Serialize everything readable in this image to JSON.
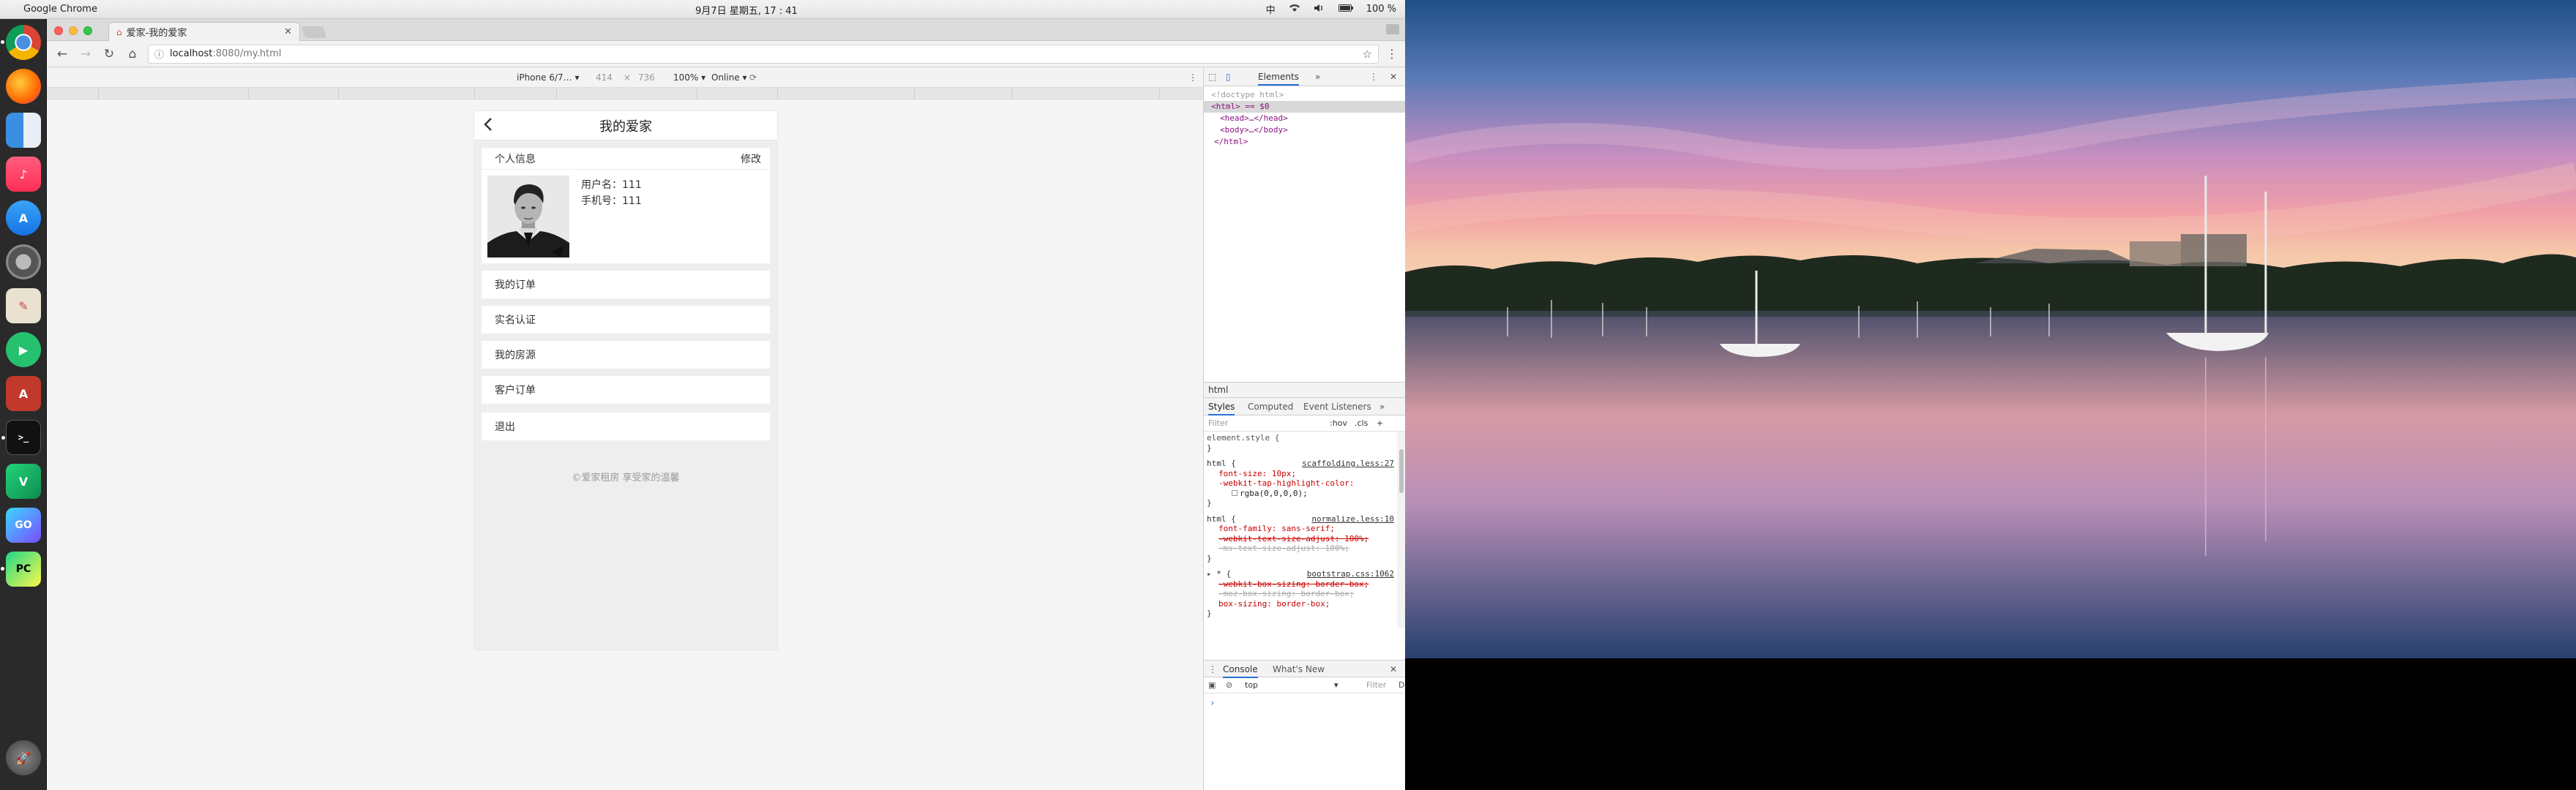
{
  "menubar": {
    "app_name": "Google Chrome",
    "clock": "9月7日 星期五, 17 : 41",
    "input_method": "中",
    "battery": "100 %"
  },
  "browser": {
    "tab_title": "爱家-我的爱家",
    "url_host": "localhost",
    "url_path": ":8080/my.html"
  },
  "device_toolbar": {
    "device": "iPhone 6/7…",
    "width": "414",
    "times": "×",
    "height": "736",
    "zoom": "100%",
    "network": "Online"
  },
  "page": {
    "title": "我的爱家",
    "section_label": "个人信息",
    "edit_label": "修改",
    "username_line": "用户名：111",
    "phone_line": "手机号：111",
    "menu_items": [
      "我的订单",
      "实名认证",
      "我的房源",
      "客户订单",
      "退出"
    ],
    "footer": "©爱家租房 享受家的温馨"
  },
  "devtools": {
    "tab_elements": "Elements",
    "more": "»",
    "dom_lines": [
      "<!doctype html>",
      "<html> == $0",
      "<head>…</head>",
      "<body>…</body>",
      "</html>"
    ],
    "breadcrumb": "html",
    "subtabs": [
      "Styles",
      "Computed",
      "Event Listeners",
      "»"
    ],
    "filter_placeholder": "Filter",
    "hov": ":hov",
    "cls": ".cls",
    "plus": "+",
    "styles": {
      "element_style": "element.style {",
      "close": "}",
      "rule1_selector": "html {",
      "rule1_source": "scaffolding.less:27",
      "rule1_props": [
        "font-size: 10px;",
        "-webkit-tap-highlight-color:",
        "rgba(0,0,0,0);"
      ],
      "rule2_selector": "html {",
      "rule2_source": "normalize.less:10",
      "rule2_props": [
        "font-family: sans-serif;",
        "-webkit-text-size-adjust: 100%;",
        "-ms-text-size-adjust: 100%;"
      ],
      "rule3_selector": "* {",
      "rule3_source": "bootstrap.css:1062",
      "rule3_props": [
        "-webkit-box-sizing: border-box;",
        "-moz-box-sizing: border-box;",
        "box-sizing: border-box;"
      ]
    },
    "drawer_tabs": [
      "Console",
      "What's New"
    ],
    "console_context": "top",
    "console_filter": "Filter",
    "console_default": "D",
    "prompt": "›"
  },
  "colors": {
    "tab_favicon": "#e74c3c",
    "dom_tag": "#881280",
    "style_prop": "#c80000"
  }
}
